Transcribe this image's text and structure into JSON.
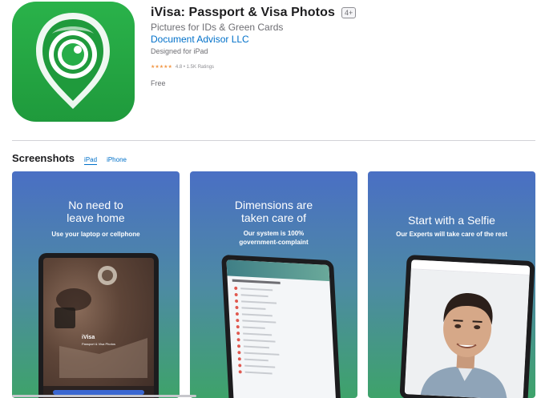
{
  "app": {
    "title": "iVisa: Passport & Visa Photos",
    "age_rating": "4+",
    "subtitle": "Pictures for IDs & Green Cards",
    "developer": "Document Advisor LLC",
    "designed_for": "Designed for iPad",
    "stars": "★★★★★",
    "rating_text": "4.8 • 1.5K Ratings",
    "price": "Free"
  },
  "screenshots": {
    "title": "Screenshots",
    "tabs": [
      {
        "label": "iPad",
        "active": true
      },
      {
        "label": "iPhone",
        "active": false
      }
    ],
    "items": [
      {
        "headline_1": "No need to",
        "headline_2": "leave home",
        "sub_1": "Use your laptop or cellphone",
        "sub_2": "",
        "device_brand": "iVisa",
        "device_tagline": "Passport & Visa Photos"
      },
      {
        "headline_1": "Dimensions are",
        "headline_2": "taken care of",
        "sub_1": "Our system is 100%",
        "sub_2": "government-complaint"
      },
      {
        "headline_1": "Start with a Selfie",
        "headline_2": "",
        "sub_1": "Our Experts will take care of the rest",
        "sub_2": ""
      }
    ]
  },
  "colors": {
    "icon_green": "#22a843",
    "link_blue": "#0070c9",
    "star_orange": "#f2994a"
  }
}
